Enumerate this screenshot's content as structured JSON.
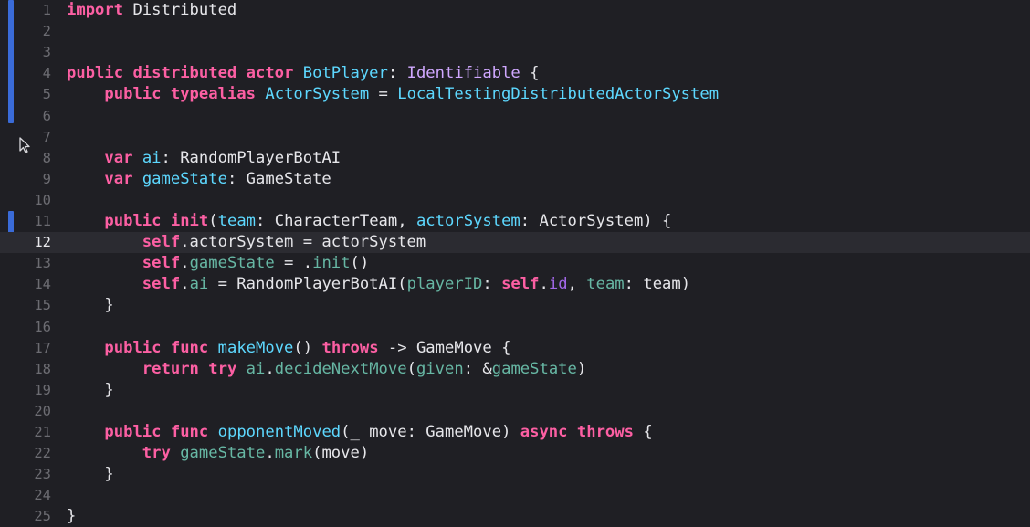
{
  "editor": {
    "current_line": 12,
    "lines": [
      {
        "n": "1",
        "tokens": [
          {
            "t": "import",
            "c": "kw"
          },
          {
            "t": " Distributed",
            "c": ""
          }
        ]
      },
      {
        "n": "2",
        "tokens": []
      },
      {
        "n": "3",
        "tokens": []
      },
      {
        "n": "4",
        "tokens": [
          {
            "t": "public",
            "c": "kw"
          },
          {
            "t": " ",
            "c": ""
          },
          {
            "t": "distributed",
            "c": "kw"
          },
          {
            "t": " ",
            "c": ""
          },
          {
            "t": "actor",
            "c": "kw"
          },
          {
            "t": " ",
            "c": ""
          },
          {
            "t": "BotPlayer",
            "c": "proj"
          },
          {
            "t": ": ",
            "c": ""
          },
          {
            "t": "Identifiable",
            "c": "type"
          },
          {
            "t": " {",
            "c": ""
          }
        ]
      },
      {
        "n": "5",
        "tokens": [
          {
            "t": "    ",
            "c": ""
          },
          {
            "t": "public",
            "c": "kw"
          },
          {
            "t": " ",
            "c": ""
          },
          {
            "t": "typealias",
            "c": "kw"
          },
          {
            "t": " ",
            "c": ""
          },
          {
            "t": "ActorSystem",
            "c": "proj"
          },
          {
            "t": " = ",
            "c": ""
          },
          {
            "t": "LocalTestingDistributedActorSystem",
            "c": "proj"
          }
        ]
      },
      {
        "n": "6",
        "tokens": []
      },
      {
        "n": "7",
        "tokens": []
      },
      {
        "n": "8",
        "tokens": [
          {
            "t": "    ",
            "c": ""
          },
          {
            "t": "var",
            "c": "kw"
          },
          {
            "t": " ",
            "c": ""
          },
          {
            "t": "ai",
            "c": "proj"
          },
          {
            "t": ": RandomPlayerBotAI",
            "c": ""
          }
        ]
      },
      {
        "n": "9",
        "tokens": [
          {
            "t": "    ",
            "c": ""
          },
          {
            "t": "var",
            "c": "kw"
          },
          {
            "t": " ",
            "c": ""
          },
          {
            "t": "gameState",
            "c": "proj"
          },
          {
            "t": ": GameState",
            "c": ""
          }
        ]
      },
      {
        "n": "10",
        "tokens": []
      },
      {
        "n": "11",
        "tokens": [
          {
            "t": "    ",
            "c": ""
          },
          {
            "t": "public",
            "c": "kw"
          },
          {
            "t": " ",
            "c": ""
          },
          {
            "t": "init",
            "c": "kw"
          },
          {
            "t": "(",
            "c": ""
          },
          {
            "t": "team",
            "c": "proj"
          },
          {
            "t": ": CharacterTeam, ",
            "c": ""
          },
          {
            "t": "actorSystem",
            "c": "proj"
          },
          {
            "t": ": ActorSystem) {",
            "c": ""
          }
        ]
      },
      {
        "n": "12",
        "tokens": [
          {
            "t": "        ",
            "c": ""
          },
          {
            "t": "self",
            "c": "kw"
          },
          {
            "t": ".actorSystem = actorSystem",
            "c": ""
          }
        ]
      },
      {
        "n": "13",
        "tokens": [
          {
            "t": "        ",
            "c": ""
          },
          {
            "t": "self",
            "c": "kw"
          },
          {
            "t": ".",
            "c": ""
          },
          {
            "t": "gameState",
            "c": "var"
          },
          {
            "t": " = .",
            "c": ""
          },
          {
            "t": "init",
            "c": "var"
          },
          {
            "t": "()",
            "c": ""
          }
        ]
      },
      {
        "n": "14",
        "tokens": [
          {
            "t": "        ",
            "c": ""
          },
          {
            "t": "self",
            "c": "kw"
          },
          {
            "t": ".",
            "c": ""
          },
          {
            "t": "ai",
            "c": "var"
          },
          {
            "t": " = RandomPlayerBotAI(",
            "c": ""
          },
          {
            "t": "playerID",
            "c": "var"
          },
          {
            "t": ": ",
            "c": ""
          },
          {
            "t": "self",
            "c": "kw"
          },
          {
            "t": ".",
            "c": ""
          },
          {
            "t": "id",
            "c": "projt"
          },
          {
            "t": ", ",
            "c": ""
          },
          {
            "t": "team",
            "c": "var"
          },
          {
            "t": ": team)",
            "c": ""
          }
        ]
      },
      {
        "n": "15",
        "tokens": [
          {
            "t": "    }",
            "c": ""
          }
        ]
      },
      {
        "n": "16",
        "tokens": []
      },
      {
        "n": "17",
        "tokens": [
          {
            "t": "    ",
            "c": ""
          },
          {
            "t": "public",
            "c": "kw"
          },
          {
            "t": " ",
            "c": ""
          },
          {
            "t": "func",
            "c": "kw"
          },
          {
            "t": " ",
            "c": ""
          },
          {
            "t": "makeMove",
            "c": "proj"
          },
          {
            "t": "() ",
            "c": ""
          },
          {
            "t": "throws",
            "c": "kw"
          },
          {
            "t": " -> GameMove {",
            "c": ""
          }
        ]
      },
      {
        "n": "18",
        "tokens": [
          {
            "t": "        ",
            "c": ""
          },
          {
            "t": "return",
            "c": "kw"
          },
          {
            "t": " ",
            "c": ""
          },
          {
            "t": "try",
            "c": "kw"
          },
          {
            "t": " ",
            "c": ""
          },
          {
            "t": "ai",
            "c": "var"
          },
          {
            "t": ".",
            "c": ""
          },
          {
            "t": "decideNextMove",
            "c": "var"
          },
          {
            "t": "(",
            "c": ""
          },
          {
            "t": "given",
            "c": "var"
          },
          {
            "t": ": &",
            "c": ""
          },
          {
            "t": "gameState",
            "c": "var"
          },
          {
            "t": ")",
            "c": ""
          }
        ]
      },
      {
        "n": "19",
        "tokens": [
          {
            "t": "    }",
            "c": ""
          }
        ]
      },
      {
        "n": "20",
        "tokens": []
      },
      {
        "n": "21",
        "tokens": [
          {
            "t": "    ",
            "c": ""
          },
          {
            "t": "public",
            "c": "kw"
          },
          {
            "t": " ",
            "c": ""
          },
          {
            "t": "func",
            "c": "kw"
          },
          {
            "t": " ",
            "c": ""
          },
          {
            "t": "opponentMoved",
            "c": "proj"
          },
          {
            "t": "(_ move: GameMove) ",
            "c": ""
          },
          {
            "t": "async",
            "c": "kw"
          },
          {
            "t": " ",
            "c": ""
          },
          {
            "t": "throws",
            "c": "kw"
          },
          {
            "t": " {",
            "c": ""
          }
        ]
      },
      {
        "n": "22",
        "tokens": [
          {
            "t": "        ",
            "c": ""
          },
          {
            "t": "try",
            "c": "kw"
          },
          {
            "t": " ",
            "c": ""
          },
          {
            "t": "gameState",
            "c": "var"
          },
          {
            "t": ".",
            "c": ""
          },
          {
            "t": "mark",
            "c": "var"
          },
          {
            "t": "(move)",
            "c": ""
          }
        ]
      },
      {
        "n": "23",
        "tokens": [
          {
            "t": "    }",
            "c": ""
          }
        ]
      },
      {
        "n": "24",
        "tokens": []
      },
      {
        "n": "25",
        "tokens": [
          {
            "t": "}",
            "c": ""
          }
        ]
      }
    ],
    "change_markers": [
      {
        "from_line": 1,
        "to_line": 6
      },
      {
        "from_line": 11,
        "to_line": 12
      }
    ]
  }
}
